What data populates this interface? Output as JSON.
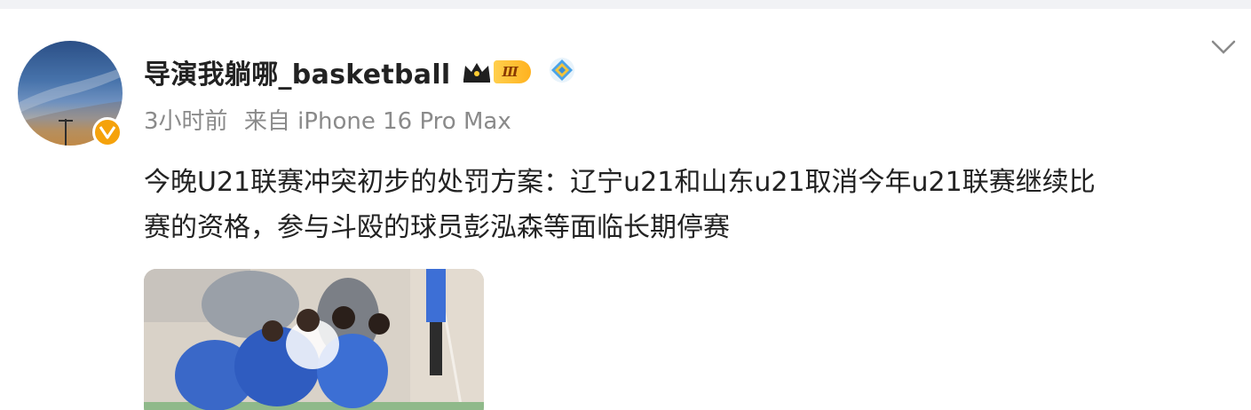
{
  "post": {
    "author": {
      "name": "导演我躺哪_basketball",
      "vip_level": "Ⅲ",
      "avatar_icon": "sunset-sky-avatar",
      "verified_icon": "orange-v-verified-icon",
      "badge_icon": "blue-diamond-icon"
    },
    "meta": {
      "time": "3小时前",
      "source": "来自 iPhone 16 Pro Max"
    },
    "text_line1": "今晚U21联赛冲突初步的处罚方案：辽宁u21和山东u21取消今年u21联赛继续比",
    "text_line2": "赛的资格，参与斗殴的球员彭泓森等面临长期停赛",
    "media": {
      "description_icon": "basketball-players-photo"
    },
    "menu_icon": "chevron-down-icon"
  },
  "colors": {
    "text": "#222222",
    "meta": "#8a8a8a",
    "verified": "#f5a20b",
    "vip_gold": "#ffb21f",
    "diamond_blue": "#4aa3e8"
  }
}
